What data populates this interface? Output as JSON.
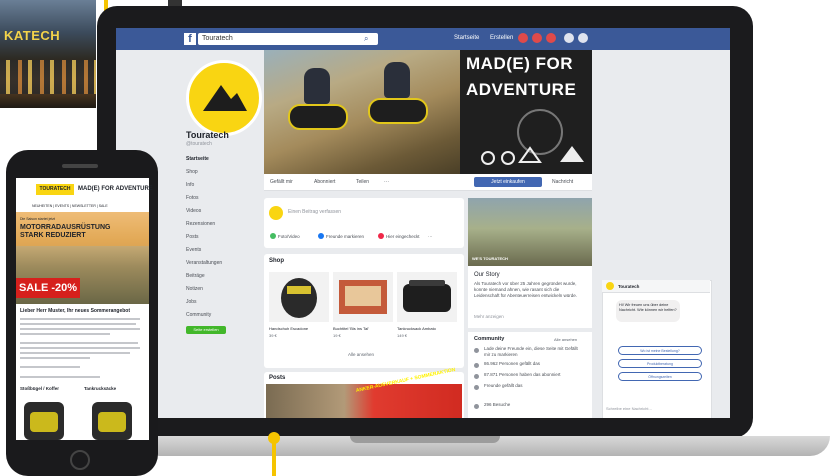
{
  "store_photo": {
    "sign_text": "KATECH"
  },
  "facebook": {
    "logo": "f",
    "search_value": "Touratech",
    "header_links": [
      "Startseite",
      "Erstellen"
    ],
    "page": {
      "name": "Touratech",
      "handle": "@touratech",
      "nav": [
        "Startseite",
        "Shop",
        "Info",
        "Fotos",
        "Videos",
        "Rezensionen",
        "Posts",
        "Events",
        "Veranstaltungen",
        "Beiträge",
        "Notizen",
        "Jobs",
        "Community"
      ],
      "nav_active_index": 0,
      "create_page_label": "Seite erstellen"
    },
    "cover": {
      "title_line1": "MAD(E) FOR",
      "title_line2": "ADVENTURE"
    },
    "actions": {
      "like": "Gefällt mir",
      "follow": "Abonniert",
      "share": "Teilen",
      "more": "···",
      "shop_now": "Jetzt einkaufen",
      "message": "Nachricht"
    },
    "composer": {
      "placeholder": "Einen Beitrag verfassen",
      "options": [
        "Foto/Video",
        "Freunde markieren",
        "Hier eingecheckt",
        "···"
      ]
    },
    "shop": {
      "title": "Shop",
      "products": [
        {
          "name": "Handschuh Escadone",
          "price": "39 €"
        },
        {
          "name": "Buchtitel 'Bis ins Tal'",
          "price": "19 €"
        },
        {
          "name": "Tankrucksack Ambato",
          "price": "149 €"
        }
      ],
      "see_all": "Alle ansehen"
    },
    "posts": {
      "title": "Posts",
      "banner": "ANKER-AUSVERKAUF + SOMMERAKTION"
    },
    "video": {
      "label": "WE'S TOURATECH"
    },
    "story": {
      "title": "Our Story",
      "text": "Als Touratech vor über 25 Jahren gegründet wurde, konnte niemand ahnen, wie rasant sich die Leidenschaft für Abenteuerreisen entwickeln würde.",
      "more": "Mehr anzeigen"
    },
    "community": {
      "title": "Community",
      "see_all": "Alle ansehen",
      "rows": [
        "Lade deine Freunde ein, diese Seite mit Gefällt mir zu markieren",
        "86.962 Personen gefällt das",
        "87.871 Personen haben das abonniert",
        "Freunde gefällt das",
        "296 Besuche"
      ]
    },
    "chat": {
      "title": "Touratech",
      "bubble": "Hi! Wir freuen uns über deine Nachricht. Wie können wir helfen?",
      "quick_replies": [
        "Wo ist meine Bestellung?",
        "Produktberatung",
        "Öffnungszeiten"
      ],
      "input_placeholder": "Schreibe eine Nachricht..."
    }
  },
  "phone": {
    "logo": "TOURATECH",
    "tagline": "MAD(E) FOR ADVENTURE",
    "nav": "NEUHEITEN | EVENTS | NEWSLETTER | SALE",
    "hero_kicker": "Die Saison startet jetzt",
    "hero_headline": "MOTORRADAUSRÜSTUNG STARK REDUZIERT",
    "sale_label": "SALE -20%",
    "greeting": "Lieber Herr Muster, Ihr neues Sommerangebot",
    "section_a": "Stoßbügel / Koffer",
    "section_b": "Tankrucksäcke"
  }
}
